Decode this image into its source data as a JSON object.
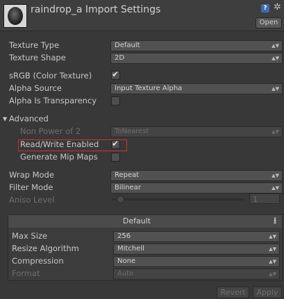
{
  "header": {
    "title": "raindrop_a Import Settings",
    "help_icon": "?",
    "open_label": "Open"
  },
  "fields": {
    "texture_type": {
      "label": "Texture Type",
      "value": "Default"
    },
    "texture_shape": {
      "label": "Texture Shape",
      "value": "2D"
    },
    "srgb": {
      "label": "sRGB (Color Texture)",
      "checked": true
    },
    "alpha_source": {
      "label": "Alpha Source",
      "value": "Input Texture Alpha"
    },
    "alpha_transparency": {
      "label": "Alpha Is Transparency",
      "checked": false
    }
  },
  "advanced": {
    "label": "Advanced",
    "non_power_of_2": {
      "label": "Non Power of 2",
      "value": "ToNearest"
    },
    "read_write": {
      "label": "Read/Write Enabled",
      "checked": true
    },
    "mip_maps": {
      "label": "Generate Mip Maps",
      "checked": false
    }
  },
  "wrap_mode": {
    "label": "Wrap Mode",
    "value": "Repeat"
  },
  "filter_mode": {
    "label": "Filter Mode",
    "value": "Bilinear"
  },
  "aniso_level": {
    "label": "Aniso Level",
    "value": "1"
  },
  "platform": {
    "label": "Default",
    "max_size": {
      "label": "Max Size",
      "value": "256"
    },
    "resize_algorithm": {
      "label": "Resize Algorithm",
      "value": "Mitchell"
    },
    "compression": {
      "label": "Compression",
      "value": "None"
    },
    "format": {
      "label": "Format",
      "value": "Auto"
    }
  },
  "footer": {
    "revert_label": "Revert",
    "apply_label": "Apply"
  },
  "colors": {
    "highlight_border": "#d03030",
    "help_blue": "#3d6bb4"
  }
}
